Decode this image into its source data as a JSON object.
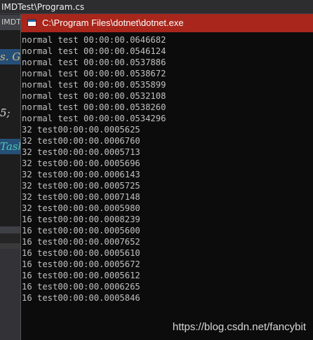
{
  "ide": {
    "title": "IMDTest\\Program.cs",
    "tab_label": "IMDT",
    "code_fragments": [
      "s. Ge",
      "5;",
      "Task"
    ]
  },
  "console": {
    "title": "C:\\Program Files\\dotnet\\dotnet.exe",
    "lines": [
      "normal test 00:00:00.0646682",
      "normal test 00:00:00.0546124",
      "normal test 00:00:00.0537886",
      "normal test 00:00:00.0538672",
      "normal test 00:00:00.0535899",
      "normal test 00:00:00.0532108",
      "normal test 00:00:00.0538260",
      "normal test 00:00:00.0534296",
      "32 test00:00:00.0005625",
      "32 test00:00:00.0006760",
      "32 test00:00:00.0005713",
      "32 test00:00:00.0005696",
      "32 test00:00:00.0006143",
      "32 test00:00:00.0005725",
      "32 test00:00:00.0007148",
      "32 test00:00:00.0005980",
      "16 test00:00:00.0008239",
      "16 test00:00:00.0005600",
      "16 test00:00:00.0007652",
      "16 test00:00:00.0005610",
      "16 test00:00:00.0005672",
      "16 test00:00:00.0005612",
      "16 test00:00:00.0006265",
      "16 test00:00:00.0005846"
    ]
  },
  "watermark": "https://blog.csdn.net/fancybit",
  "colors": {
    "console_titlebar": "#a8261b",
    "console_background": "#0c0c0c",
    "console_text": "#c0c0c0",
    "ide_background": "#1e1e1e"
  }
}
